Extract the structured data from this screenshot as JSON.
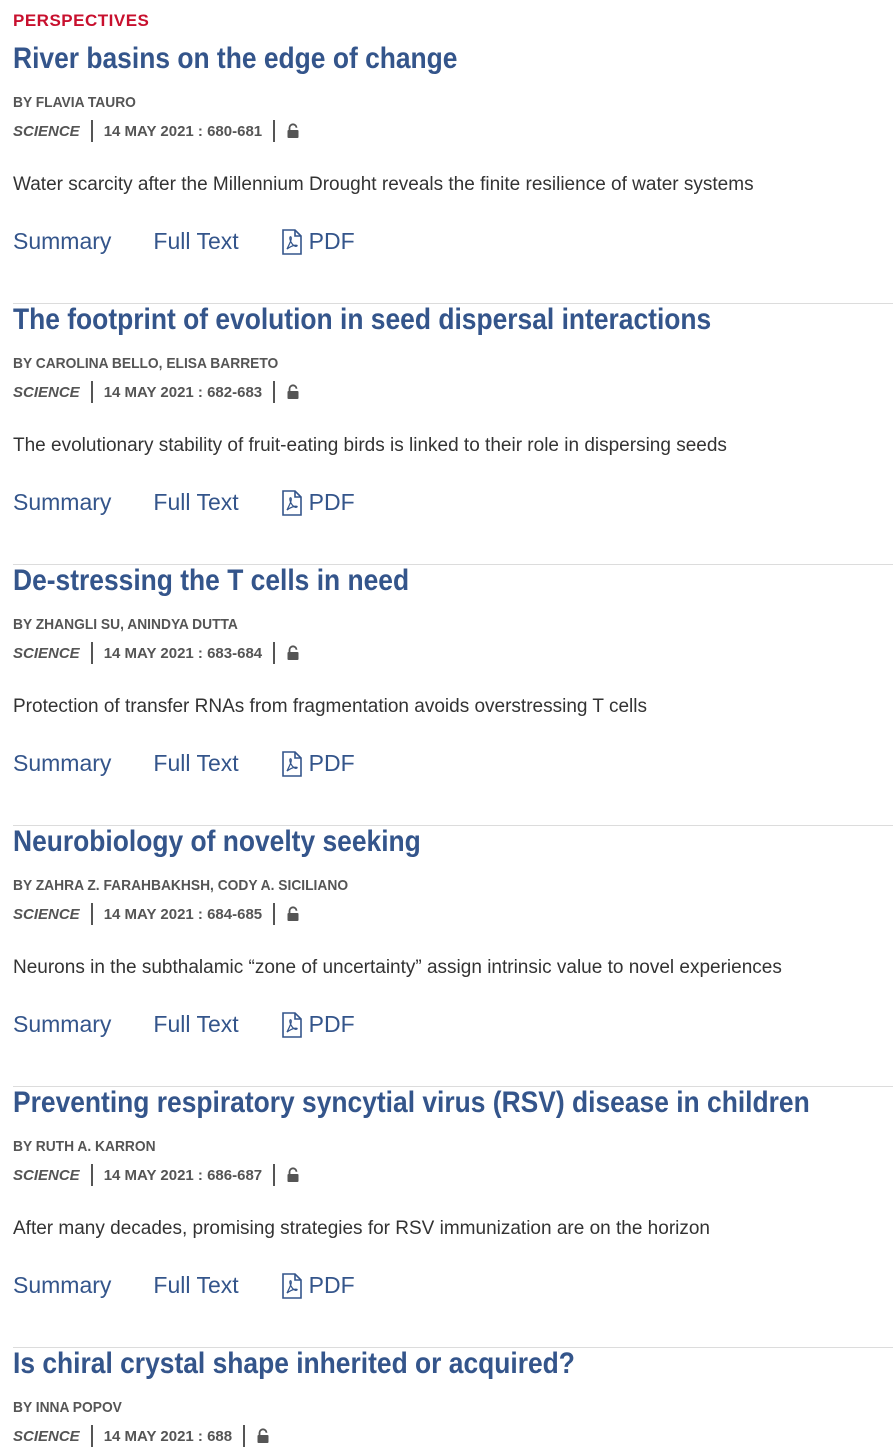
{
  "section_label": "PERSPECTIVES",
  "link_labels": {
    "summary": "Summary",
    "full_text": "Full Text",
    "pdf": "PDF"
  },
  "colors": {
    "section_label": "#c8102e",
    "title": "#34558b",
    "link": "#34558b",
    "meta": "#555555",
    "divider": "#dcdcdc"
  },
  "articles": [
    {
      "title": "River basins on the edge of change",
      "authors": "BY FLAVIA TAURO",
      "journal": "SCIENCE",
      "date_pages": "14 MAY 2021 : 680-681",
      "access_icon": "lock-icon",
      "summary": "Water scarcity after the Millennium Drought reveals the finite resilience of water systems"
    },
    {
      "title": "The footprint of evolution in seed dispersal interactions",
      "authors": "BY CAROLINA BELLO, ELISA BARRETO",
      "journal": "SCIENCE",
      "date_pages": "14 MAY 2021 : 682-683",
      "access_icon": "lock-icon",
      "summary": "The evolutionary stability of fruit-eating birds is linked to their role in dispersing seeds"
    },
    {
      "title": "De-stressing the T cells in need",
      "authors": "BY ZHANGLI SU, ANINDYA DUTTA",
      "journal": "SCIENCE",
      "date_pages": "14 MAY 2021 : 683-684",
      "access_icon": "lock-icon",
      "summary": "Protection of transfer RNAs from fragmentation avoids overstressing T cells"
    },
    {
      "title": "Neurobiology of novelty seeking",
      "authors": "BY ZAHRA Z. FARAHBAKHSH, CODY A. SICILIANO",
      "journal": "SCIENCE",
      "date_pages": "14 MAY 2021 : 684-685",
      "access_icon": "lock-icon",
      "summary": "Neurons in the subthalamic “zone of uncertainty” assign intrinsic value to novel experiences"
    },
    {
      "title": "Preventing respiratory syncytial virus (RSV) disease in children",
      "authors": "BY RUTH A. KARRON",
      "journal": "SCIENCE",
      "date_pages": "14 MAY 2021 : 686-687",
      "access_icon": "lock-icon",
      "summary": "After many decades, promising strategies for RSV immunization are on the horizon"
    },
    {
      "title": "Is chiral crystal shape inherited or acquired?",
      "authors": "BY INNA POPOV",
      "journal": "SCIENCE",
      "date_pages": "14 MAY 2021 : 688",
      "access_icon": "lock-icon",
      "summary": ""
    }
  ]
}
